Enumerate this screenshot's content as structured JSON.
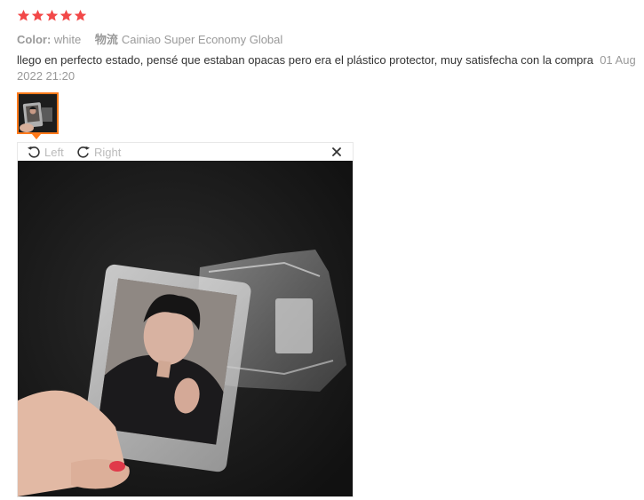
{
  "review": {
    "rating": 5,
    "star_color": "#f24848",
    "color_label": "Color:",
    "color_value": "white",
    "logistics_label": "物流",
    "logistics_value": "Cainiao Super Economy Global",
    "comment": "llego en perfecto estado, pensé que estaban opacas pero era el plástico protector, muy satisfecha con la compra",
    "date": "01 Aug 2022 21:20"
  },
  "viewer": {
    "rotate_left_label": "Left",
    "rotate_right_label": "Right",
    "accent": "#ff7a1a"
  }
}
